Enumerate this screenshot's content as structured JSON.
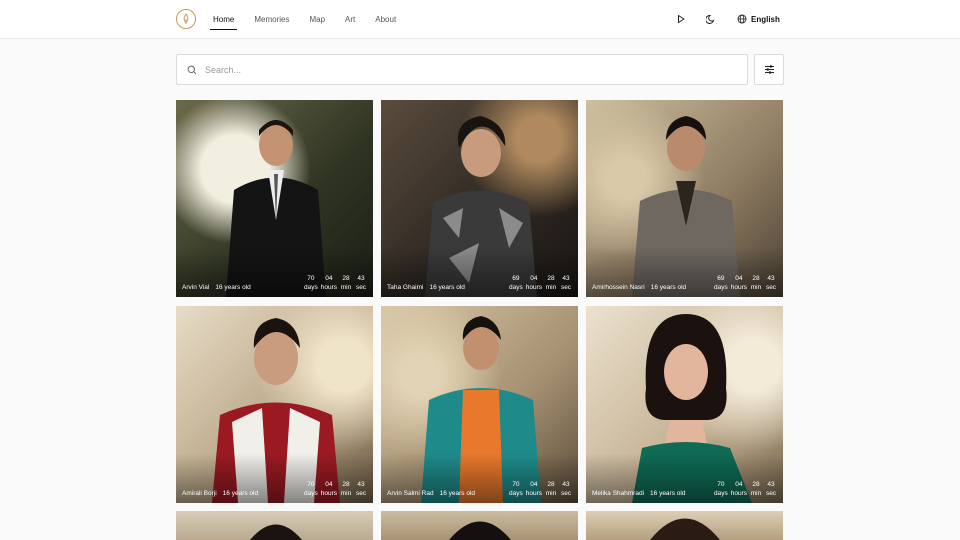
{
  "header": {
    "nav": [
      "Home",
      "Memories",
      "Map",
      "Art",
      "About"
    ],
    "language": "English",
    "icons": {
      "logo": "candle-flame-logo",
      "play": "play-icon",
      "theme": "moon-icon",
      "globe": "globe-icon"
    },
    "colors": {
      "accent": "#c79a5a"
    }
  },
  "search": {
    "placeholder": "Search...",
    "value": ""
  },
  "units": {
    "days": "days",
    "hours": "hours",
    "min": "min",
    "sec": "sec"
  },
  "cards": [
    {
      "name": "Arvin Vial",
      "age": "16 years old",
      "days": "70",
      "hours": "04",
      "min": "28",
      "sec": "43"
    },
    {
      "name": "Taha Ghaimi",
      "age": "16 years old",
      "days": "69",
      "hours": "04",
      "min": "28",
      "sec": "43"
    },
    {
      "name": "Amirhossein Nasri",
      "age": "16 years old",
      "days": "69",
      "hours": "04",
      "min": "28",
      "sec": "43"
    },
    {
      "name": "Amirali Borji",
      "age": "16 years old",
      "days": "70",
      "hours": "04",
      "min": "28",
      "sec": "43"
    },
    {
      "name": "Arvin Salmi Rad",
      "age": "16 years old",
      "days": "70",
      "hours": "04",
      "min": "28",
      "sec": "43"
    },
    {
      "name": "Melika Shahmradi",
      "age": "16 years old",
      "days": "70",
      "hours": "04",
      "min": "28",
      "sec": "43"
    }
  ]
}
